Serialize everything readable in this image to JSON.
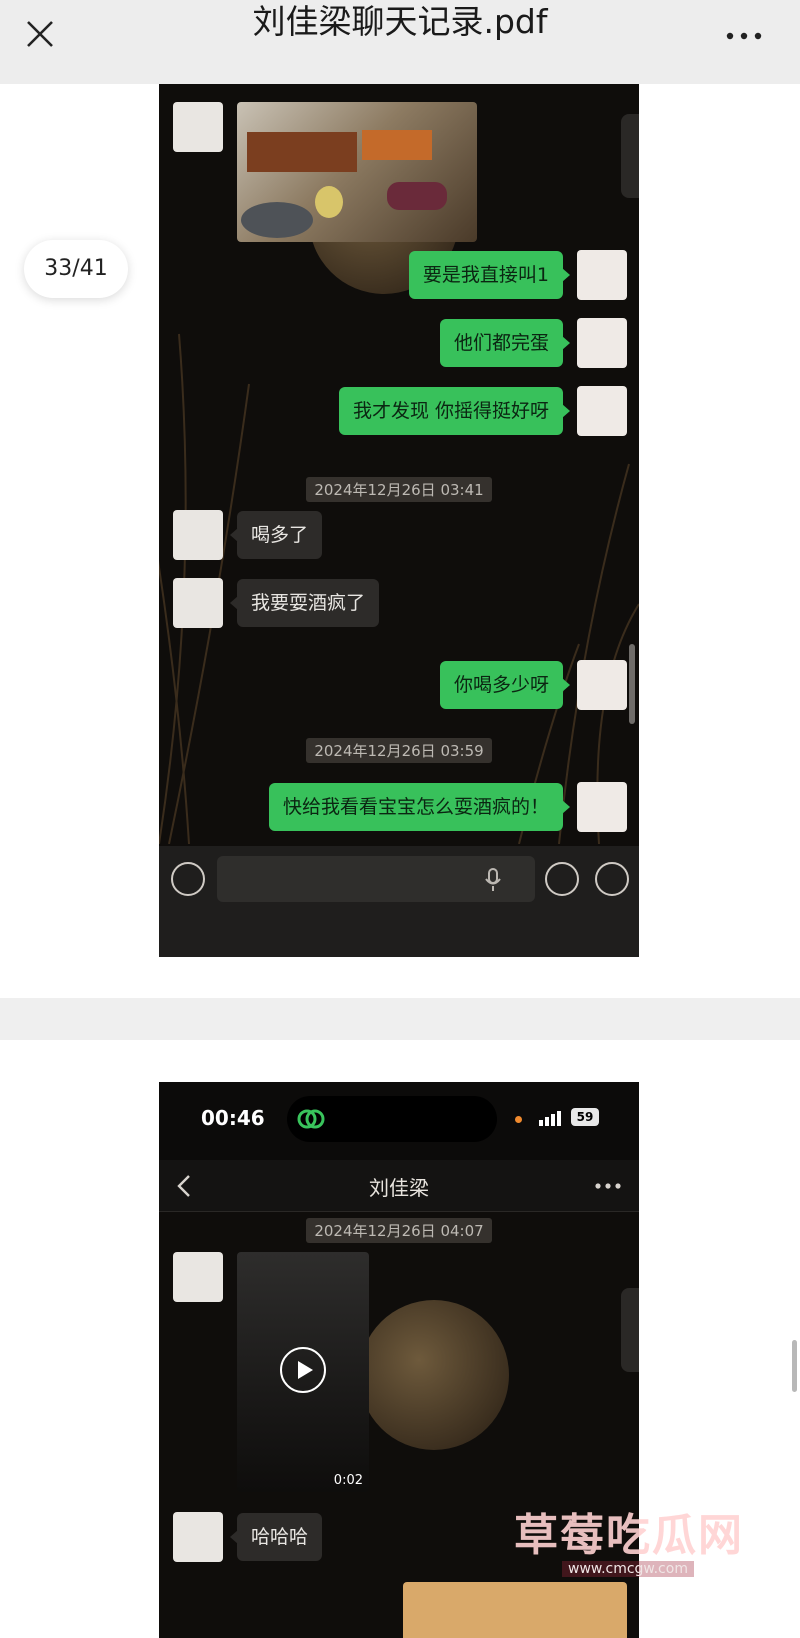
{
  "app": {
    "title": "刘佳梁聊天记录.pdf"
  },
  "viewer": {
    "page_indicator": "33/41"
  },
  "page1": {
    "messages": [
      {
        "dir": "out",
        "text": "要是我直接叫1"
      },
      {
        "dir": "out",
        "text": "他们都完蛋"
      },
      {
        "dir": "out",
        "text": "我才发现 你摇得挺好呀"
      },
      {
        "dir": "in",
        "text": "喝多了"
      },
      {
        "dir": "in",
        "text": "我要耍酒疯了"
      },
      {
        "dir": "out",
        "text": "你喝多少呀"
      },
      {
        "dir": "out",
        "text": "快给我看看宝宝怎么耍酒疯的！"
      }
    ],
    "timestamps": [
      "2024年12月26日 03:41",
      "2024年12月26日 03:59"
    ]
  },
  "page2": {
    "status_time": "00:46",
    "battery": "59",
    "contact_name": "刘佳梁",
    "timestamp": "2024年12月26日 04:07",
    "video_duration": "0:02",
    "message": "哈哈哈"
  },
  "watermark": {
    "text": "草莓吃瓜网",
    "url": "www.cmcgw.com"
  }
}
